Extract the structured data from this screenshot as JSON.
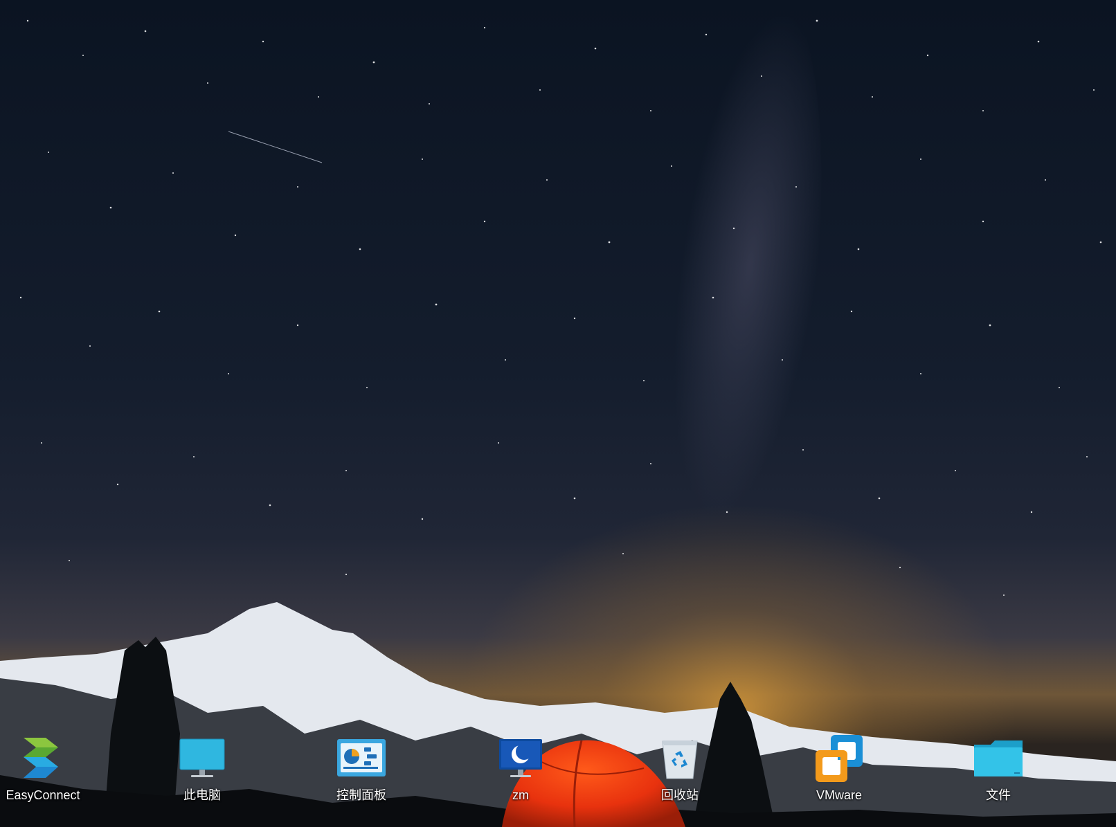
{
  "desktop": {
    "wallpaper": "night-sky-mountain-tent",
    "icons": [
      {
        "label": "EasyConnect",
        "icon": "easyconnect-icon"
      },
      {
        "label": "此电脑",
        "icon": "computer-monitor-icon"
      },
      {
        "label": "控制面板",
        "icon": "control-panel-icon"
      },
      {
        "label": "zm",
        "icon": "moon-monitor-icon"
      },
      {
        "label": "回收站",
        "icon": "recycle-bin-icon"
      },
      {
        "label": "VMware",
        "icon": "vmware-icon"
      },
      {
        "label": "文件",
        "icon": "folder-icon"
      }
    ]
  },
  "colors": {
    "label": "#ffffff",
    "tent": "#e8320e",
    "sky": "#121b2a"
  }
}
